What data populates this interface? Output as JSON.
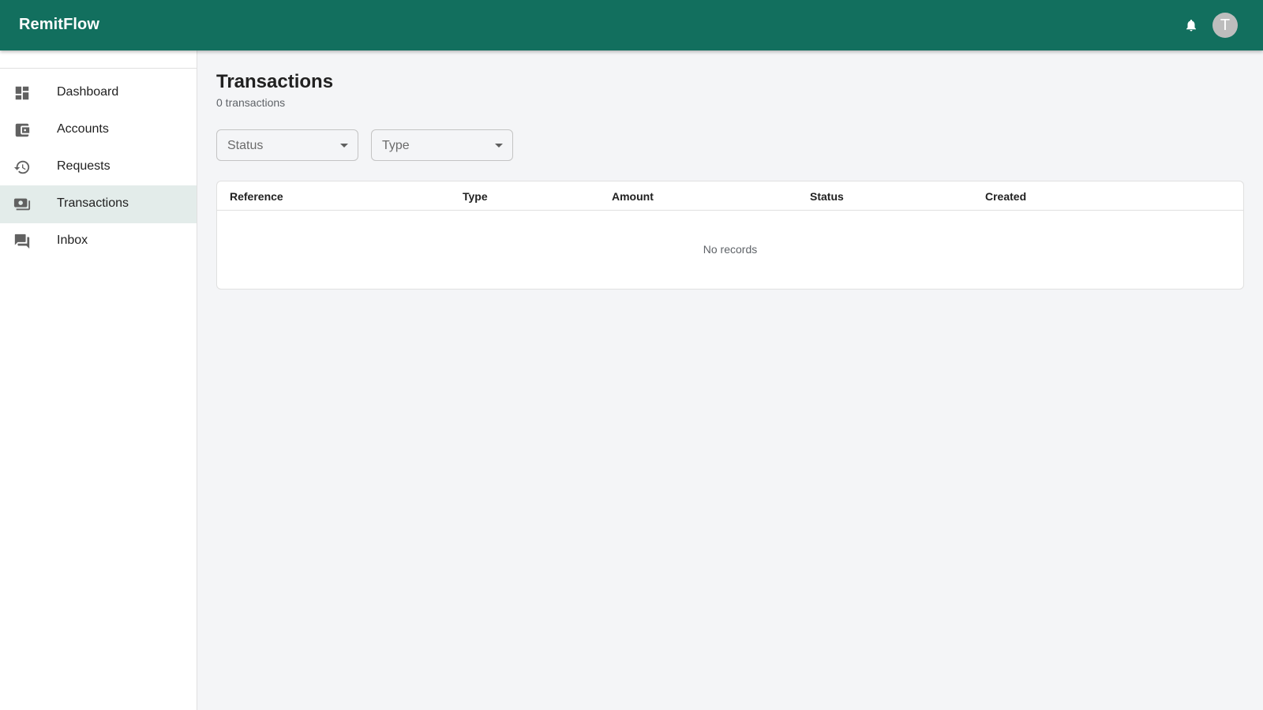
{
  "app": {
    "brand": "RemitFlow",
    "avatar_initial": "T",
    "colors": {
      "appbar": "#126f5e",
      "active_nav": "#e3ecea",
      "background": "#f4f5f7"
    }
  },
  "header": {
    "notifications_icon": "bell-icon"
  },
  "sidebar": {
    "items": [
      {
        "label": "Dashboard",
        "icon": "dashboard-icon",
        "active": false
      },
      {
        "label": "Accounts",
        "icon": "wallet-icon",
        "active": false
      },
      {
        "label": "Requests",
        "icon": "history-icon",
        "active": false
      },
      {
        "label": "Transactions",
        "icon": "payments-icon",
        "active": true
      },
      {
        "label": "Inbox",
        "icon": "forum-icon",
        "active": false
      }
    ]
  },
  "main": {
    "title": "Transactions",
    "subtitle": "0 transactions",
    "filters": {
      "status": {
        "label": "Status"
      },
      "type": {
        "label": "Type"
      }
    },
    "table": {
      "columns": [
        "Reference",
        "Type",
        "Amount",
        "Status",
        "Created"
      ],
      "rows": [],
      "empty_text": "No records"
    }
  }
}
